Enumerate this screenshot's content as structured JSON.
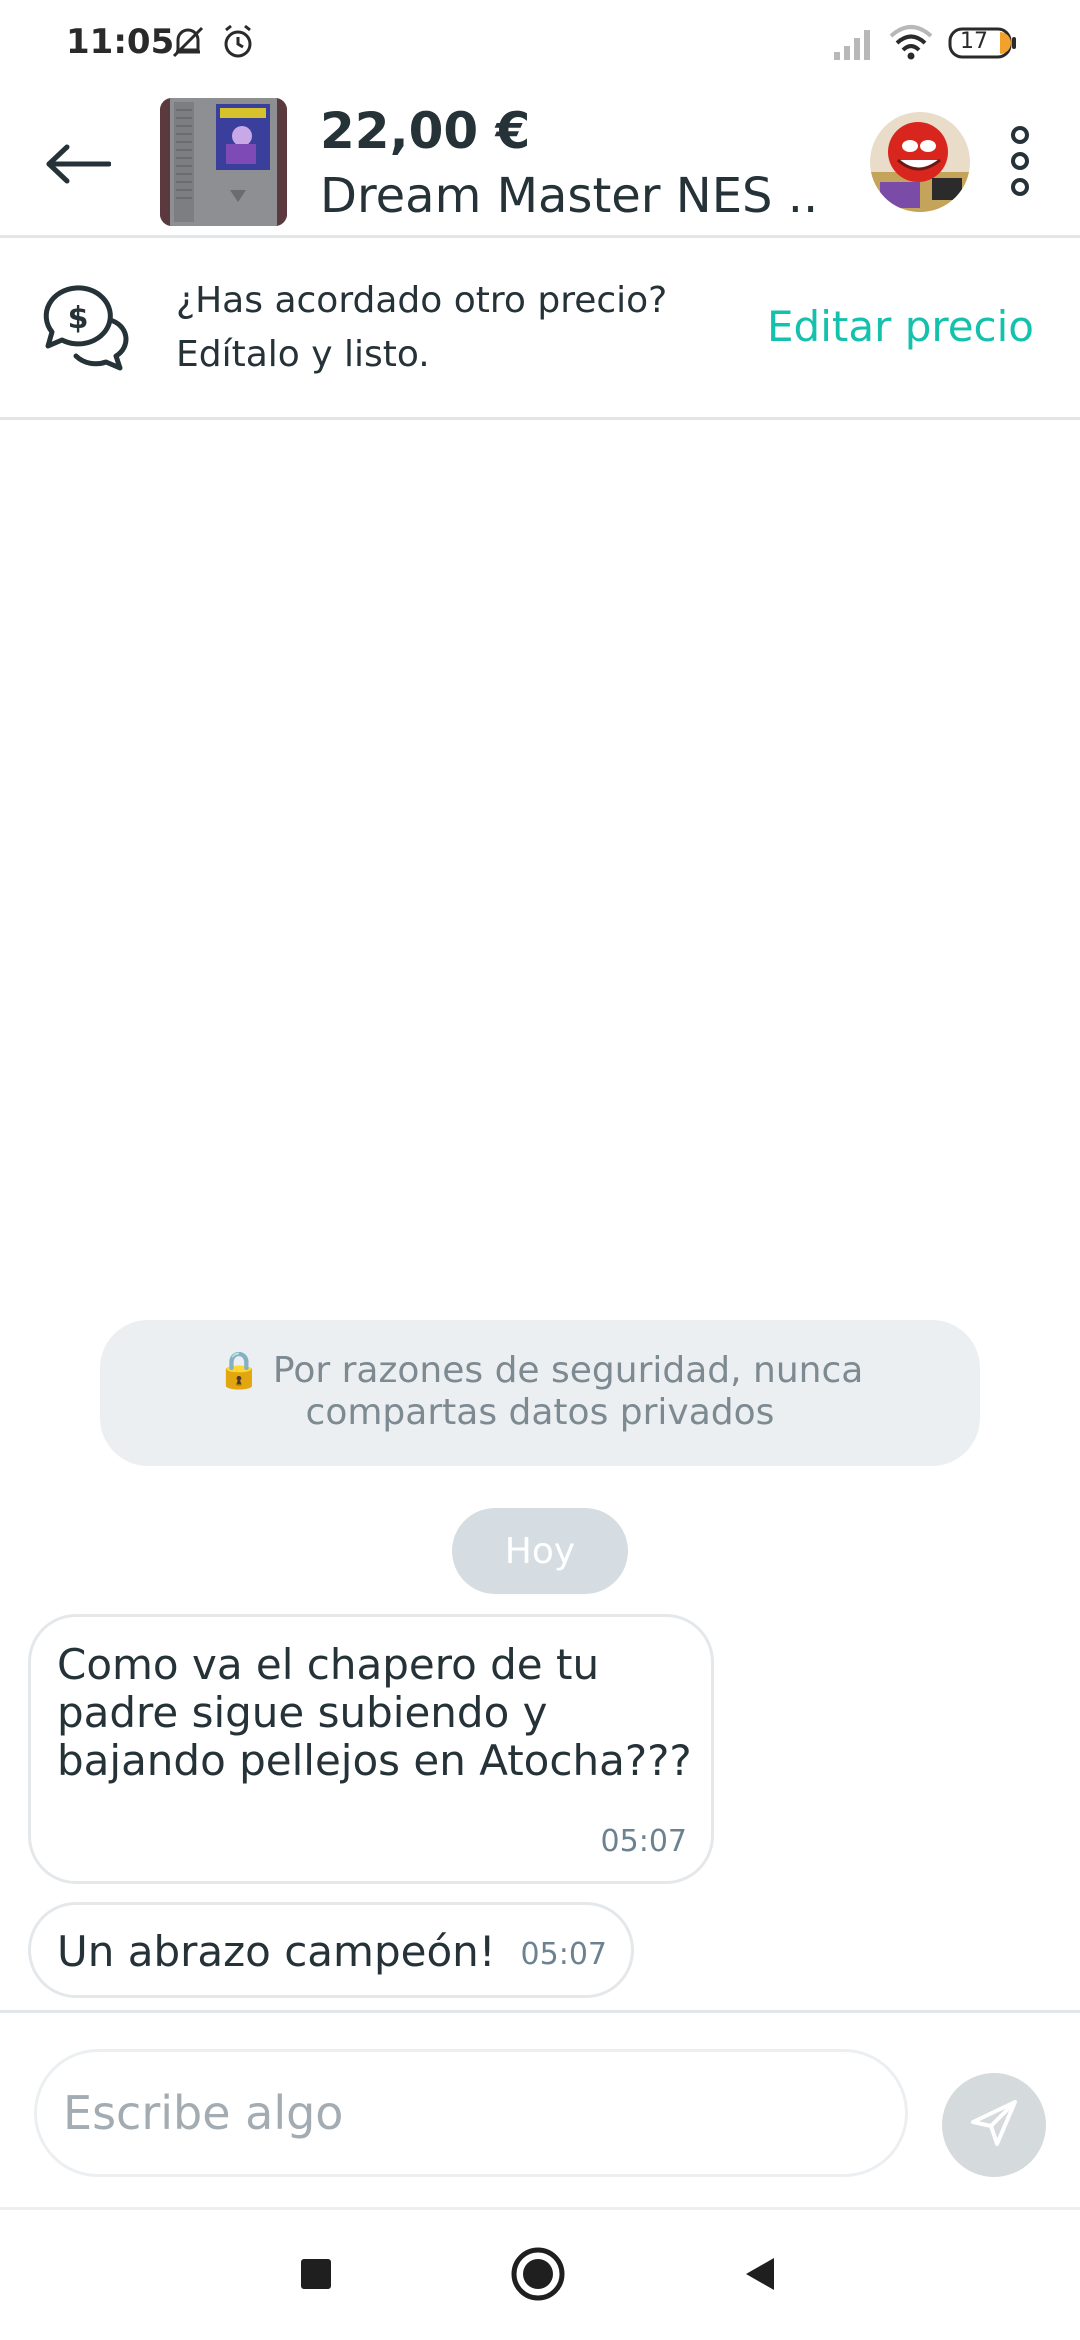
{
  "status_bar": {
    "time": "11:05",
    "battery": "17",
    "icons": [
      "mute-icon",
      "alarm-icon",
      "signal-icon",
      "wifi-icon",
      "battery-icon"
    ]
  },
  "header": {
    "price": "22,00 €",
    "title": "Dream Master NES ...",
    "icons": [
      "back-arrow-icon",
      "more-vertical-icon"
    ]
  },
  "price_banner": {
    "line1": "¿Has acordado otro precio?",
    "line2": "Edítalo y listo.",
    "edit_label": "Editar precio",
    "icon": "chat-dollar-icon"
  },
  "chat": {
    "security_line1": "🔒 Por razones de seguridad, nunca",
    "security_line2": "compartas datos privados",
    "day_label": "Hoy",
    "messages": [
      {
        "text": "Como va el chapero de tu padre sigue subiendo y bajando pellejos en Atocha???",
        "time": "05:07"
      },
      {
        "text": "Un abrazo campeón!",
        "time": "05:07"
      }
    ]
  },
  "composer": {
    "placeholder": "Escribe algo",
    "send_icon": "send-icon"
  },
  "colors": {
    "accent": "#13c1ac",
    "text": "#253238",
    "muted": "#7d8a92"
  }
}
